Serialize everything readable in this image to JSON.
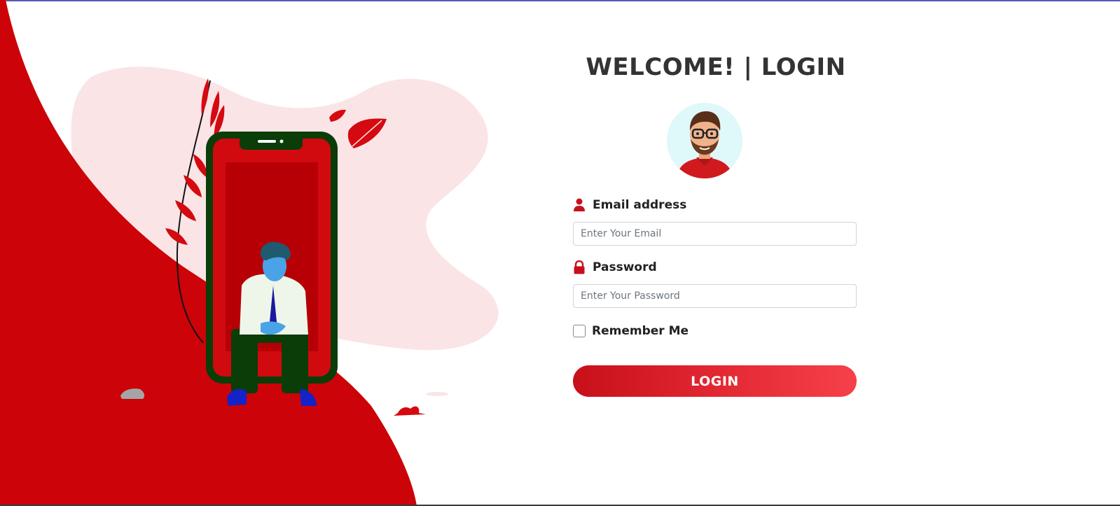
{
  "colors": {
    "accent": "#c8101a",
    "accent_light": "#f6404a",
    "blob": "#fbe4e6",
    "title": "#333333"
  },
  "login": {
    "title": "WELCOME! | LOGIN",
    "email_label": "Email address",
    "email_icon": "user-icon",
    "email_placeholder": "Enter Your Email",
    "email_value": "",
    "password_label": "Password",
    "password_icon": "lock-icon",
    "password_placeholder": "Enter Your Password",
    "password_value": "",
    "remember_label": "Remember Me",
    "remember_checked": false,
    "login_button": "LOGIN"
  }
}
